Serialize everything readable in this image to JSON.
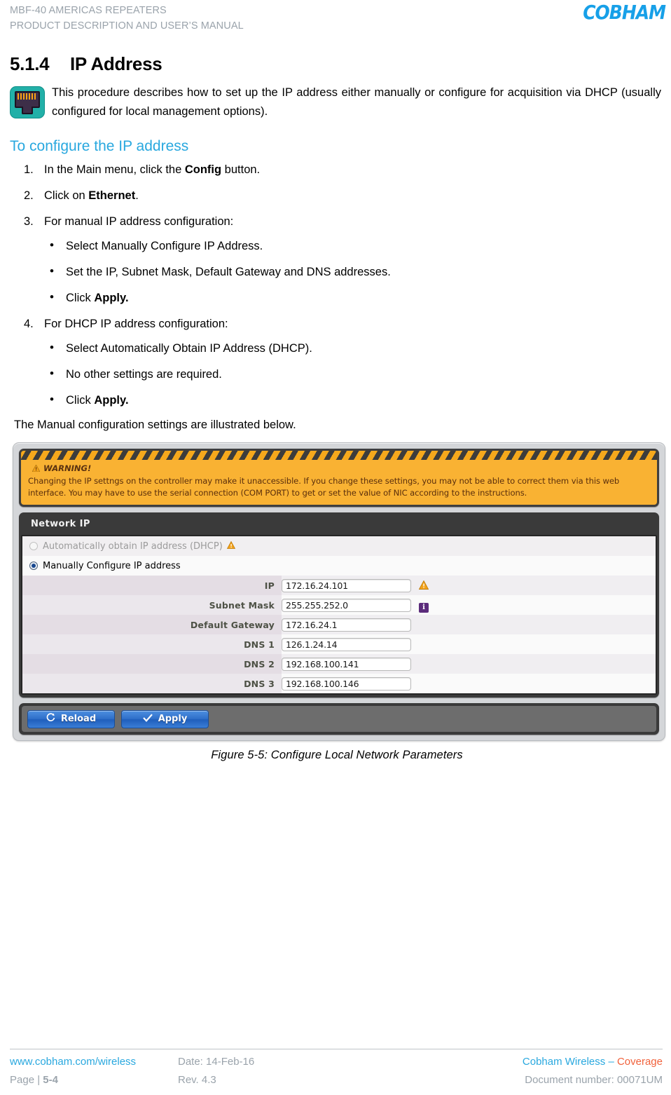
{
  "header": {
    "line1": "MBF-40 AMERICAS REPEATERS",
    "line2": "PRODUCT DESCRIPTION AND USER’S MANUAL",
    "logo": "COBHAM"
  },
  "section": {
    "number": "5.1.4",
    "title": "IP Address",
    "intro": "This procedure describes how to set up the IP address either manually or configure for acquisition via DHCP (usually configured for local management options).",
    "subheading": "To configure the IP address"
  },
  "steps": [
    {
      "n": "1.",
      "pre": "In the Main menu, click the ",
      "bold": "Config",
      "post": " button.",
      "bullets": []
    },
    {
      "n": "2.",
      "pre": "Click on ",
      "bold": "Ethernet",
      "post": ".",
      "bullets": []
    },
    {
      "n": "3.",
      "pre": "For manual IP address configuration:",
      "bold": "",
      "post": "",
      "bullets": [
        {
          "pre": "Select Manually Configure IP Address.",
          "bold": "",
          "post": ""
        },
        {
          "pre": "Set the IP, Subnet Mask, Default Gateway and DNS addresses.",
          "bold": "",
          "post": ""
        },
        {
          "pre": "Click ",
          "bold": "Apply.",
          "post": ""
        }
      ]
    },
    {
      "n": "4.",
      "pre": "For DHCP IP address configuration:",
      "bold": "",
      "post": "",
      "bullets": [
        {
          "pre": "Select Automatically Obtain IP Address (DHCP).",
          "bold": "",
          "post": ""
        },
        {
          "pre": "No other settings are required.",
          "bold": "",
          "post": ""
        },
        {
          "pre": "Click ",
          "bold": "Apply.",
          "post": ""
        }
      ]
    }
  ],
  "closing_line": "The Manual configuration settings are illustrated below.",
  "figure": {
    "warning": {
      "title": "WARNING!",
      "text": "Changing the IP settngs on the controller may make it unaccessible. If you change these settings, you may not be able to correct them via this web interface. You may have to use the serial connection (COM PORT) to get or set the value of NIC according to the instructions."
    },
    "panel_title": "Network IP",
    "radios": [
      {
        "label": "Automatically obtain IP address (DHCP)",
        "selected": false,
        "has_warning_icon": true
      },
      {
        "label": "Manually Configure IP address",
        "selected": true,
        "has_warning_icon": false
      }
    ],
    "fields": [
      {
        "label": "IP",
        "value": "172.16.24.101",
        "icon": "warning-icon"
      },
      {
        "label": "Subnet Mask",
        "value": "255.255.252.0",
        "icon": "info-icon"
      },
      {
        "label": "Default Gateway",
        "value": "172.16.24.1",
        "icon": ""
      },
      {
        "label": "DNS 1",
        "value": "126.1.24.14",
        "icon": ""
      },
      {
        "label": "DNS 2",
        "value": "192.168.100.141",
        "icon": ""
      },
      {
        "label": "DNS 3",
        "value": "192.168.100.146",
        "icon": ""
      }
    ],
    "buttons": [
      {
        "label": "Reload",
        "icon": "reload-icon"
      },
      {
        "label": "Apply",
        "icon": "check-icon"
      }
    ],
    "caption": "Figure 5-5:  Configure Local Network Parameters"
  },
  "footer": {
    "website": "www.cobham.com/wireless",
    "page_prefix": "Page | ",
    "page_number": "5-4",
    "date": "Date: 14-Feb-16",
    "rev": "Rev. 4.3",
    "brand": "Cobham Wireless ",
    "brand_dash": "– ",
    "brand_accent": "Coverage",
    "doc_number": "Document number: 00071UM"
  },
  "colors": {
    "accent_blue": "#29a8df",
    "logo_blue": "#17a0e8",
    "orange": "#f1623c",
    "warn_bg": "#f9b233",
    "info_purple": "#5b2b7b"
  }
}
